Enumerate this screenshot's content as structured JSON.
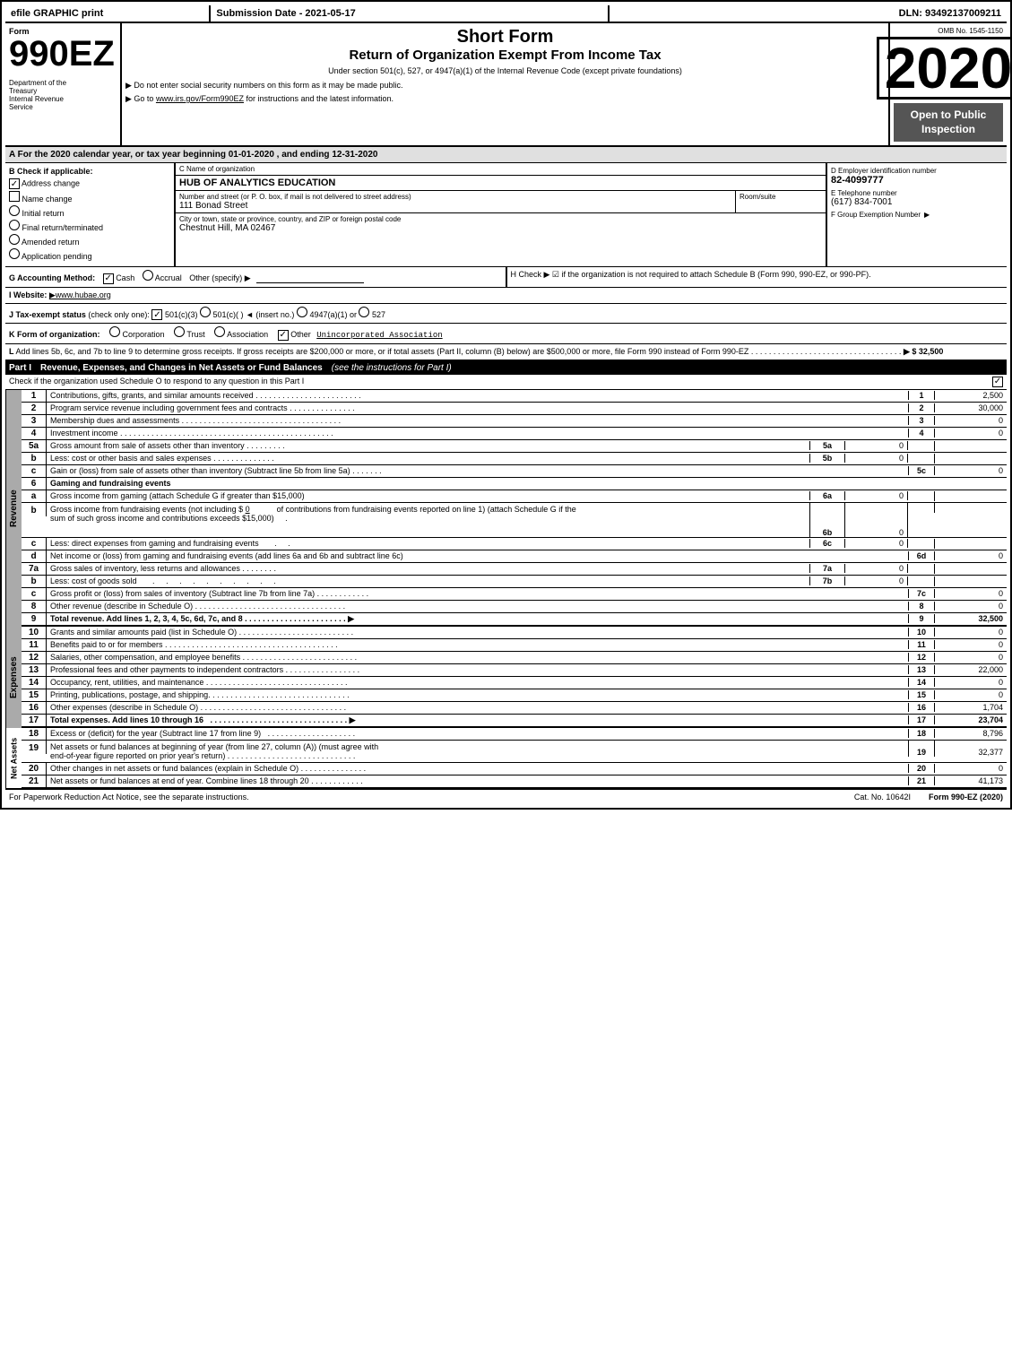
{
  "header": {
    "left": "efile GRAPHIC print",
    "mid": "Submission Date - 2021-05-17",
    "right": "DLN: 93492137009211"
  },
  "form": {
    "number": "990EZ",
    "omb": "OMB No. 1545-1150",
    "title1": "Short Form",
    "title2": "Return of Organization Exempt From Income Tax",
    "subtitle": "Under section 501(c), 527, or 4947(a)(1) of the Internal Revenue Code (except private foundations)",
    "note1": "▶ Do not enter social security numbers on this form as it may be made public.",
    "note2": "▶ Go to www.irs.gov/Form990EZ for instructions and the latest information.",
    "year": "2020",
    "open_label": "Open to Public Inspection"
  },
  "dept": {
    "line1": "Department of the",
    "line2": "Treasury",
    "line3": "Internal Revenue",
    "line4": "Service"
  },
  "section_a": {
    "text": "A  For the 2020 calendar year, or tax year beginning 01-01-2020 , and ending 12-31-2020"
  },
  "section_b": {
    "label": "B  Check if applicable:",
    "address_change": "Address change",
    "name_change": "Name change",
    "initial_return": "Initial return",
    "final_return": "Final return/terminated",
    "amended_return": "Amended return",
    "application_pending": "Application pending",
    "address_checked": true,
    "name_checked": false,
    "initial_checked": false,
    "final_checked": false,
    "amended_checked": false,
    "application_checked": false
  },
  "section_c": {
    "label": "C Name of organization",
    "name": "HUB OF ANALYTICS EDUCATION",
    "address_label": "Number and street (or P. O. box, if mail is not delivered to street address)",
    "address": "111 Bonad Street",
    "room_label": "Room/suite",
    "room": "",
    "city_label": "City or town, state or province, country, and ZIP or foreign postal code",
    "city": "Chestnut Hill, MA  02467"
  },
  "section_d": {
    "label": "D Employer identification number",
    "ein": "82-4099777",
    "e_label": "E Telephone number",
    "phone": "(617) 834-7001",
    "f_label": "F Group Exemption Number",
    "f_value": "▶"
  },
  "section_g": {
    "label": "G Accounting Method:",
    "cash": "Cash",
    "accrual": "Accrual",
    "other": "Other (specify) ▶",
    "cash_checked": true,
    "accrual_checked": false
  },
  "section_h": {
    "text": "H  Check ▶  ☑ if the organization is not required to attach Schedule B (Form 990, 990-EZ, or 990-PF)."
  },
  "section_i": {
    "label": "I Website: ▶www.hubae.org"
  },
  "section_j": {
    "label": "J Tax-exempt status (check only one): ☑ 501(c)(3) ○ 501(c)(  ) ◄ (insert no.) ○ 4947(a)(1) or ○ 527"
  },
  "section_k": {
    "label": "K Form of organization:",
    "corporation": "Corporation",
    "trust": "Trust",
    "association": "Association",
    "other": "Other",
    "other_value": "Unincorporated Association",
    "other_checked": true
  },
  "section_l": {
    "text": "L Add lines 5b, 6c, and 7b to line 9 to determine gross receipts. If gross receipts are $200,000 or more, or if total assets (Part II, column (B) below) are $500,000 or more, file Form 990 instead of Form 990-EZ",
    "amount": "▶ $ 32,500"
  },
  "part1": {
    "title": "Part I",
    "subtitle": "Revenue, Expenses, and Changes in Net Assets or Fund Balances",
    "instructions": "(see the instructions for Part I)",
    "check_note": "Check if the organization used Schedule O to respond to any question in this Part I",
    "lines": [
      {
        "num": "1",
        "desc": "Contributions, gifts, grants, and similar amounts received",
        "dots": true,
        "line_ref": "",
        "amount": "",
        "right_num": "1",
        "final": "2,500"
      },
      {
        "num": "2",
        "desc": "Program service revenue including government fees and contracts",
        "dots": true,
        "line_ref": "",
        "amount": "",
        "right_num": "2",
        "final": "30,000"
      },
      {
        "num": "3",
        "desc": "Membership dues and assessments",
        "dots": true,
        "line_ref": "",
        "amount": "",
        "right_num": "3",
        "final": "0"
      },
      {
        "num": "4",
        "desc": "Investment income",
        "dots": true,
        "line_ref": "",
        "amount": "",
        "right_num": "4",
        "final": "0"
      },
      {
        "num": "5a",
        "desc": "Gross amount from sale of assets other than inventory",
        "dots": false,
        "line_ref": "5a",
        "amount": "0",
        "right_num": "",
        "final": ""
      },
      {
        "num": "5b",
        "desc": "Less: cost or other basis and sales expenses",
        "dots": false,
        "line_ref": "5b",
        "amount": "0",
        "right_num": "",
        "final": ""
      },
      {
        "num": "5c",
        "desc": "Gain or (loss) from sale of assets other than inventory (Subtract line 5b from line 5a)",
        "dots": true,
        "line_ref": "",
        "amount": "",
        "right_num": "5c",
        "final": "0"
      },
      {
        "num": "6",
        "desc": "Gaming and fundraising events",
        "dots": false,
        "line_ref": "",
        "amount": "",
        "right_num": "",
        "final": ""
      },
      {
        "num": "6a",
        "desc": "Gross income from gaming (attach Schedule G if greater than $15,000)",
        "dots": false,
        "line_ref": "6a",
        "amount": "0",
        "right_num": "",
        "final": ""
      },
      {
        "num": "6b",
        "desc": "Gross income from fundraising events (not including $ 0 of contributions from fundraising events reported on line 1) (attach Schedule G if the sum of such gross income and contributions exceeds $15,000)",
        "dots": false,
        "line_ref": "6b",
        "amount": "0",
        "right_num": "",
        "final": ""
      },
      {
        "num": "6c",
        "desc": "Less: direct expenses from gaming and fundraising events",
        "dots": false,
        "line_ref": "6c",
        "amount": "0",
        "right_num": "",
        "final": ""
      },
      {
        "num": "6d",
        "desc": "Net income or (loss) from gaming and fundraising events (add lines 6a and 6b and subtract line 6c)",
        "dots": true,
        "line_ref": "",
        "amount": "",
        "right_num": "6d",
        "final": "0"
      },
      {
        "num": "7a",
        "desc": "Gross sales of inventory, less returns and allowances",
        "dots": true,
        "line_ref": "7a",
        "amount": "0",
        "right_num": "",
        "final": ""
      },
      {
        "num": "7b",
        "desc": "Less: cost of goods sold",
        "dots": true,
        "line_ref": "7b",
        "amount": "0",
        "right_num": "",
        "final": ""
      },
      {
        "num": "7c",
        "desc": "Gross profit or (loss) from sales of inventory (Subtract line 7b from line 7a)",
        "dots": true,
        "line_ref": "",
        "amount": "",
        "right_num": "7c",
        "final": "0"
      },
      {
        "num": "8",
        "desc": "Other revenue (describe in Schedule O)",
        "dots": true,
        "line_ref": "",
        "amount": "",
        "right_num": "8",
        "final": "0"
      },
      {
        "num": "9",
        "desc": "Total revenue. Add lines 1, 2, 3, 4, 5c, 6d, 7c, and 8",
        "dots": true,
        "line_ref": "",
        "amount": "",
        "right_num": "9",
        "final": "32,500",
        "bold": true,
        "arrow": true
      }
    ]
  },
  "part1_expenses": {
    "lines": [
      {
        "num": "10",
        "desc": "Grants and similar amounts paid (list in Schedule O)",
        "dots": true,
        "right_num": "10",
        "final": "0"
      },
      {
        "num": "11",
        "desc": "Benefits paid to or for members",
        "dots": true,
        "right_num": "11",
        "final": "0"
      },
      {
        "num": "12",
        "desc": "Salaries, other compensation, and employee benefits",
        "dots": true,
        "right_num": "12",
        "final": "0"
      },
      {
        "num": "13",
        "desc": "Professional fees and other payments to independent contractors",
        "dots": true,
        "right_num": "13",
        "final": "22,000"
      },
      {
        "num": "14",
        "desc": "Occupancy, rent, utilities, and maintenance",
        "dots": true,
        "right_num": "14",
        "final": "0"
      },
      {
        "num": "15",
        "desc": "Printing, publications, postage, and shipping",
        "dots": true,
        "right_num": "15",
        "final": "0"
      },
      {
        "num": "16",
        "desc": "Other expenses (describe in Schedule O)",
        "dots": true,
        "right_num": "16",
        "final": "1,704"
      },
      {
        "num": "17",
        "desc": "Total expenses. Add lines 10 through 16",
        "dots": true,
        "right_num": "17",
        "final": "23,704",
        "bold": true,
        "arrow": true
      }
    ]
  },
  "part1_net": {
    "lines": [
      {
        "num": "18",
        "desc": "Excess or (deficit) for the year (Subtract line 17 from line 9)",
        "dots": true,
        "right_num": "18",
        "final": "8,796"
      },
      {
        "num": "19",
        "desc": "Net assets or fund balances at beginning of year (from line 27, column (A)) (must agree with end-of-year figure reported on prior year's return)",
        "dots": true,
        "right_num": "19",
        "final": "32,377"
      },
      {
        "num": "20",
        "desc": "Other changes in net assets or fund balances (explain in Schedule O)",
        "dots": true,
        "right_num": "20",
        "final": "0"
      },
      {
        "num": "21",
        "desc": "Net assets or fund balances at end of year. Combine lines 18 through 20",
        "dots": true,
        "right_num": "21",
        "final": "41,173"
      }
    ]
  },
  "footer": {
    "left": "For Paperwork Reduction Act Notice, see the separate instructions.",
    "cat": "Cat. No. 10642I",
    "right": "Form 990-EZ (2020)"
  }
}
